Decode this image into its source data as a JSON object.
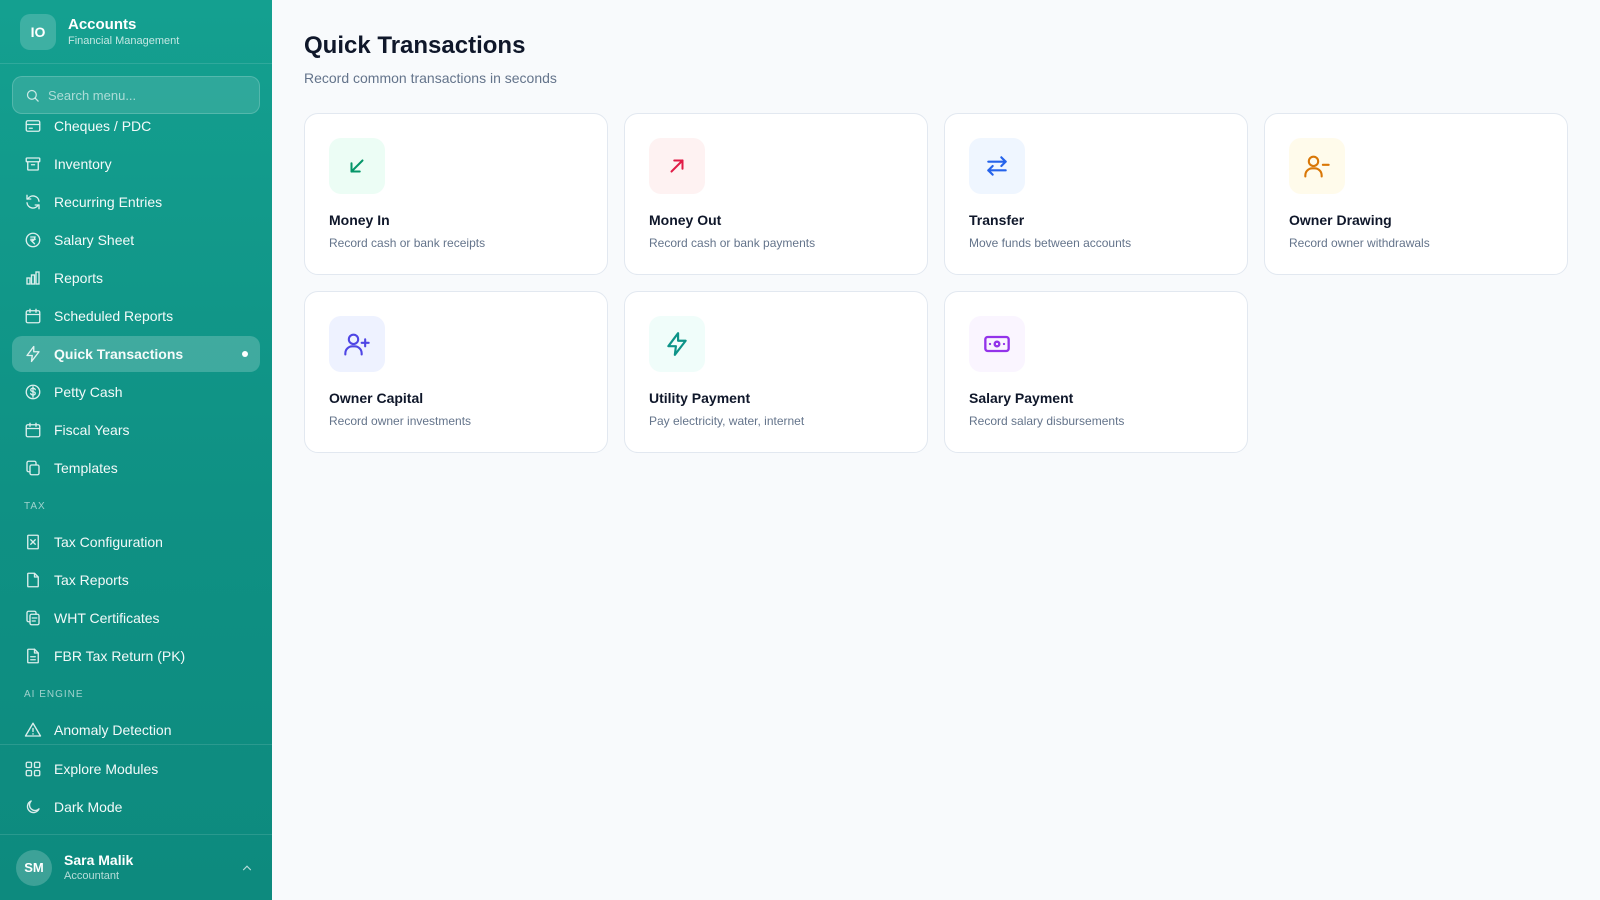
{
  "brand": {
    "logo": "IO",
    "title": "Accounts",
    "subtitle": "Financial Management"
  },
  "search": {
    "placeholder": "Search menu..."
  },
  "nav": {
    "items": [
      {
        "label": "Cheques / PDC",
        "icon": "cheque-icon"
      },
      {
        "label": "Inventory",
        "icon": "archive-icon"
      },
      {
        "label": "Recurring Entries",
        "icon": "refresh-icon"
      },
      {
        "label": "Salary Sheet",
        "icon": "rupee-coin-icon"
      },
      {
        "label": "Reports",
        "icon": "bar-chart-icon"
      },
      {
        "label": "Scheduled Reports",
        "icon": "calendar-icon"
      },
      {
        "label": "Quick Transactions",
        "icon": "lightning-icon",
        "active": true
      },
      {
        "label": "Petty Cash",
        "icon": "dollar-coin-icon"
      },
      {
        "label": "Fiscal Years",
        "icon": "calendar-icon"
      },
      {
        "label": "Templates",
        "icon": "copy-icon"
      }
    ],
    "tax_label": "TAX",
    "tax_items": [
      {
        "label": "Tax Configuration",
        "icon": "receipt-icon"
      },
      {
        "label": "Tax Reports",
        "icon": "file-icon"
      },
      {
        "label": "WHT Certificates",
        "icon": "certificate-icon"
      },
      {
        "label": "FBR Tax Return (PK)",
        "icon": "file-text-icon"
      }
    ],
    "ai_label": "AI ENGINE",
    "ai_items": [
      {
        "label": "Anomaly Detection",
        "icon": "warning-triangle-icon"
      }
    ]
  },
  "bottom": {
    "explore": "Explore Modules",
    "dark_mode": "Dark Mode"
  },
  "user": {
    "initials": "SM",
    "name": "Sara Malik",
    "role": "Accountant"
  },
  "page": {
    "title": "Quick Transactions",
    "subtitle": "Record common transactions in seconds"
  },
  "cards": [
    {
      "title": "Money In",
      "desc": "Record cash or bank receipts",
      "icon": "arrow-down-left-icon",
      "color": "#059669",
      "bg": "#ecfdf5"
    },
    {
      "title": "Money Out",
      "desc": "Record cash or bank payments",
      "icon": "arrow-up-right-icon",
      "color": "#e11d48",
      "bg": "#fef2f2"
    },
    {
      "title": "Transfer",
      "desc": "Move funds between accounts",
      "icon": "transfer-arrows-icon",
      "color": "#2563eb",
      "bg": "#eff6ff"
    },
    {
      "title": "Owner Drawing",
      "desc": "Record owner withdrawals",
      "icon": "user-minus-icon",
      "color": "#d97706",
      "bg": "#fffbeb"
    },
    {
      "title": "Owner Capital",
      "desc": "Record owner investments",
      "icon": "user-plus-icon",
      "color": "#4f46e5",
      "bg": "#eef2ff"
    },
    {
      "title": "Utility Payment",
      "desc": "Pay electricity, water, internet",
      "icon": "lightning-icon",
      "color": "#0d9488",
      "bg": "#f0fdfa"
    },
    {
      "title": "Salary Payment",
      "desc": "Record salary disbursements",
      "icon": "banknote-icon",
      "color": "#9333ea",
      "bg": "#faf5ff"
    }
  ]
}
